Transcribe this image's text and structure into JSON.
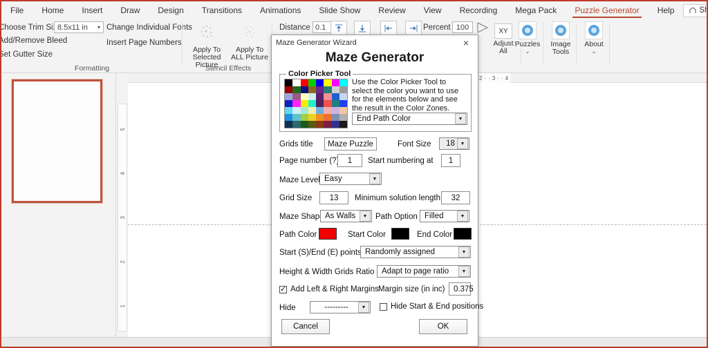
{
  "app": {
    "tabs": [
      {
        "label": "File",
        "active": false
      },
      {
        "label": "Home",
        "active": false
      },
      {
        "label": "Insert",
        "active": false
      },
      {
        "label": "Draw",
        "active": false
      },
      {
        "label": "Design",
        "active": false
      },
      {
        "label": "Transitions",
        "active": false
      },
      {
        "label": "Animations",
        "active": false
      },
      {
        "label": "Slide Show",
        "active": false
      },
      {
        "label": "Review",
        "active": false
      },
      {
        "label": "View",
        "active": false
      },
      {
        "label": "Recording",
        "active": false
      },
      {
        "label": "Mega Pack",
        "active": false
      },
      {
        "label": "Puzzle Generator",
        "active": true
      },
      {
        "label": "Help",
        "active": false
      }
    ],
    "share_label": "Share",
    "accent_color": "#b7472a"
  },
  "ribbon": {
    "formatting": {
      "group_title": "Formatting",
      "choose_trim_size_label": "Choose Trim Size",
      "trim_size_value": "8.5x11 in",
      "add_remove_bleed_label": "Add/Remove Bleed",
      "set_gutter_size_label": "Set Gutter Size",
      "change_individual_fonts_label": "Change Individual Fonts",
      "insert_page_numbers_label": "Insert Page Numbers"
    },
    "stencil": {
      "group_title": "Stencil Effects",
      "apply_selected_label": "Apply To\nSelected Picture",
      "apply_selected_line1": "Apply To",
      "apply_selected_line2": "Selected Picture",
      "apply_all_line1": "Apply To",
      "apply_all_line2": "ALL Picture"
    },
    "align": {
      "distance_label": "Distance",
      "distance_value": "0.1",
      "percent_label": "Percent",
      "percent_value": "100",
      "adjust_all_line1": "Adjust",
      "adjust_all_line2": "All",
      "adjust_all_icon_text": "XY"
    },
    "tools": [
      {
        "label": "Puzzles",
        "has_chevron": true
      },
      {
        "label": "Image",
        "label2": "Tools",
        "has_chevron": true
      },
      {
        "label": "About",
        "has_chevron": true
      }
    ]
  },
  "workspace": {
    "vertical_ruler_ticks": [
      "5",
      "4",
      "3",
      "2",
      "1"
    ],
    "horizontal_ruler_ticks": [
      "2",
      "·",
      "·",
      "3",
      "·",
      "·",
      "4"
    ]
  },
  "dialog": {
    "window_title": "Maze Generator Wizard",
    "heading": "Maze Generator",
    "close_icon": "×",
    "color_picker": {
      "legend": "Color Picker Tool",
      "help_text": "Use the Color Picker Tool to select the color you want to use for the elements below and see the result in the Color Zones.",
      "target_select_value": "End Path Color",
      "swatches": [
        "#000000",
        "#ffffff",
        "#ff0000",
        "#00d000",
        "#0000f0",
        "#ffff00",
        "#ff00ff",
        "#00ffff",
        "#a00000",
        "#1f6b1f",
        "#101080",
        "#8a6b20",
        "#6b2a8a",
        "#2a7d7d",
        "#cfcfcf",
        "#9a9a9a",
        "#9aa8e0",
        "#9a5a8a",
        "#ffffc0",
        "#cfeff0",
        "#5a1f6b",
        "#f09090",
        "#2060d0",
        "#c8d8f0",
        "#1020c0",
        "#ff20ff",
        "#f0f000",
        "#20f0d0",
        "#502060",
        "#f05050",
        "#208080",
        "#2040f0",
        "#60d8f0",
        "#c8f0f8",
        "#a8e8d0",
        "#f0f0b0",
        "#70b0e0",
        "#f0b0b0",
        "#d0b0e0",
        "#f0c8a0",
        "#2090e0",
        "#60c0d0",
        "#a0d040",
        "#f0d020",
        "#f09020",
        "#f07030",
        "#8090b0",
        "#b0b0b0",
        "#103050",
        "#2a6a6a",
        "#1a5a1a",
        "#5a5a10",
        "#8a3a10",
        "#7a2040",
        "#303090",
        "#1a1a1a"
      ]
    },
    "fields": {
      "grids_title_label": "Grids title",
      "grids_title_value": "Maze Puzzle",
      "font_size_label": "Font Size",
      "font_size_value": "18",
      "page_number_label": "Page number (?)",
      "page_number_value": "1",
      "start_numbering_label": "Start numbering at",
      "start_numbering_value": "1",
      "maze_level_label": "Maze Level",
      "maze_level_value": "Easy",
      "grid_size_label": "Grid Size",
      "grid_size_value": "13",
      "min_solution_label": "Minimum solution length",
      "min_solution_value": "32",
      "maze_shape_label": "Maze Shape",
      "maze_shape_value": "As Walls",
      "path_option_label": "Path Option",
      "path_option_value": "Filled",
      "path_color_label": "Path Color",
      "path_color_value": "#f00000",
      "start_color_label": "Start Color",
      "start_color_value": "#000000",
      "end_color_label": "End Color",
      "end_color_value": "#000000",
      "start_end_points_label": "Start (S)/End (E) points",
      "start_end_points_value": "Randomly assigned",
      "ratio_label": "Height & Width Grids Ratio",
      "ratio_value": "Adapt to page ratio",
      "margins_checkbox_label": "Add Left & Right Margins",
      "margins_checked": true,
      "margin_size_label": "Margin size (in inc)",
      "margin_size_value": "0.375",
      "hide_label": "Hide",
      "hide_value": "---------",
      "hide_start_end_label": "Hide Start & End positions",
      "hide_start_end_checked": false
    },
    "buttons": {
      "cancel_label": "Cancel",
      "ok_label": "OK"
    }
  }
}
